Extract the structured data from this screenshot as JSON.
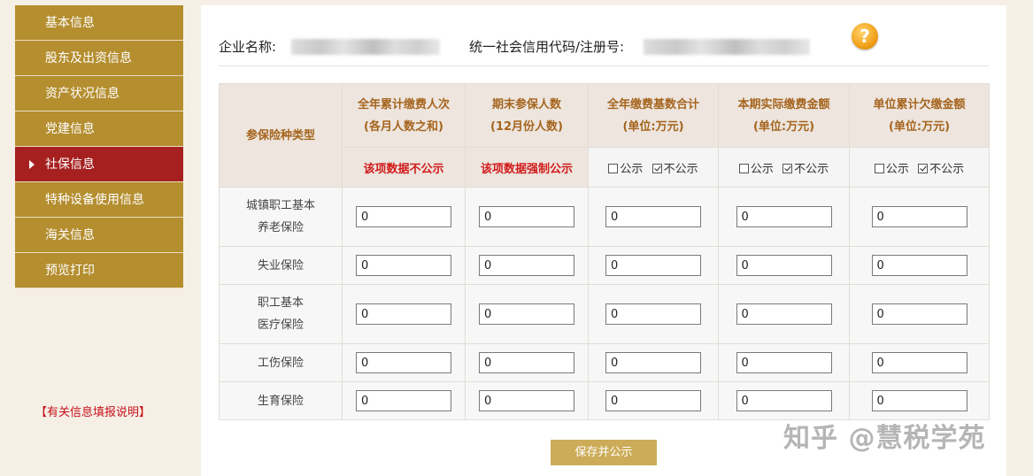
{
  "sidebar": {
    "items": [
      {
        "label": "基本信息",
        "active": false
      },
      {
        "label": "股东及出资信息",
        "active": false
      },
      {
        "label": "资产状况信息",
        "active": false
      },
      {
        "label": "党建信息",
        "active": false
      },
      {
        "label": "社保信息",
        "active": true
      },
      {
        "label": "特种设备使用信息",
        "active": false
      },
      {
        "label": "海关信息",
        "active": false
      },
      {
        "label": "预览打印",
        "active": false
      }
    ],
    "help_link": "【有关信息填报说明】"
  },
  "company": {
    "name_label": "企业名称:",
    "code_label": "统一社会信用代码/注册号:",
    "help_icon": "question-icon"
  },
  "table": {
    "row_header": "参保险种类型",
    "columns": [
      {
        "line1": "全年累计缴费人次",
        "line2": "(各月人数之和)",
        "note": "该项数据不公示"
      },
      {
        "line1": "期末参保人数",
        "line2": "(12月份人数)",
        "note": "该项数据强制公示"
      },
      {
        "line1": "全年缴费基数合计",
        "line2": "(单位:万元)",
        "public_label": "公示",
        "private_label": "不公示",
        "private_checked": true
      },
      {
        "line1": "本期实际缴费金额",
        "line2": "(单位:万元)",
        "public_label": "公示",
        "private_label": "不公示",
        "private_checked": true
      },
      {
        "line1": "单位累计欠缴金额",
        "line2": "(单位:万元)",
        "public_label": "公示",
        "private_label": "不公示",
        "private_checked": true
      }
    ],
    "rows": [
      {
        "type_line1": "城镇职工基本",
        "type_line2": "养老保险",
        "values": [
          "0",
          "0",
          "0",
          "0",
          "0"
        ]
      },
      {
        "type_line1": "失业保险",
        "type_line2": "",
        "values": [
          "0",
          "0",
          "0",
          "0",
          "0"
        ]
      },
      {
        "type_line1": "职工基本",
        "type_line2": "医疗保险",
        "values": [
          "0",
          "0",
          "0",
          "0",
          "0"
        ]
      },
      {
        "type_line1": "工伤保险",
        "type_line2": "",
        "values": [
          "0",
          "0",
          "0",
          "0",
          "0"
        ]
      },
      {
        "type_line1": "生育保险",
        "type_line2": "",
        "values": [
          "0",
          "0",
          "0",
          "0",
          "0"
        ]
      }
    ]
  },
  "save_button": "保存并公示",
  "watermark": "知乎 @慧税学苑",
  "colors": {
    "nav": "#b48e2f",
    "nav_active": "#a5201f",
    "header_bg": "#ede5de",
    "header_text": "#a5641d",
    "note_text": "#d11b1b",
    "button": "#ccac58"
  }
}
